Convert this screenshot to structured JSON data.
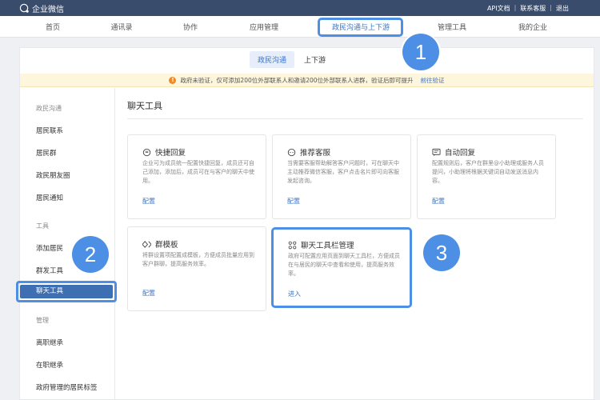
{
  "topbar": {
    "logo_text": "企业微信",
    "links": [
      "API文档",
      "联系客服",
      "退出"
    ]
  },
  "nav": {
    "items": [
      "首页",
      "通讯录",
      "协作",
      "应用管理",
      "政民沟通与上下游",
      "管理工具",
      "我的企业"
    ],
    "active_index": 4
  },
  "subtabs": [
    "政民沟通",
    "上下游"
  ],
  "notice": {
    "text": "政府未验证，仅可添加200位外部联系人和邀请200位外部联系人进群，验证后即可提升",
    "link": "前往验证"
  },
  "sidebar": {
    "group1": "政民沟通",
    "group1_items": [
      "居民联系",
      "居民群",
      "政民朋友圈",
      "居民通知"
    ],
    "group2": "工具",
    "group2_items": [
      "添加居民",
      "群发工具",
      "聊天工具"
    ],
    "group3": "管理",
    "group3_items": [
      "离职继承",
      "在职继承",
      "政府管理的居民标签"
    ]
  },
  "content": {
    "title": "聊天工具",
    "cards": [
      {
        "title": "快捷回复",
        "icon": "chat-bubble-icon",
        "desc": "企业可为成员统一配置快捷回复，成员还可自己添加，添加后，成员可在与客户的聊天中使用。",
        "link": "配置"
      },
      {
        "title": "推荐客服",
        "icon": "service-chat-icon",
        "desc": "当需要客服帮助解答客户问题时，可在聊天中主动推荐微信客服，客户点击名片即可向客服发起咨询。",
        "link": "配置"
      },
      {
        "title": "自动回复",
        "icon": "auto-reply-icon",
        "desc": "配置规则后，客户在群里@小助理或服务人员提问，小助理将根据关键词自动发送消息内容。",
        "link": "配置"
      },
      {
        "title": "群模板",
        "icon": "diamond-template-icon",
        "desc": "将群设置项配置成模板，方便成员批量应用到客户群聊，提高服务效率。",
        "link": "配置"
      },
      {
        "title": "聊天工具栏管理",
        "icon": "toolbar-grid-icon",
        "desc": "政府可配置应用页面到聊天工具栏，方便成员在与居民的聊天中查看和使用，提高服务效率。",
        "link": "进入"
      }
    ]
  },
  "badges": [
    "1",
    "2",
    "3"
  ],
  "colors": {
    "highlight": "#4d8fe4",
    "topbar": "#3a4c6b",
    "link": "#3b75c8"
  }
}
